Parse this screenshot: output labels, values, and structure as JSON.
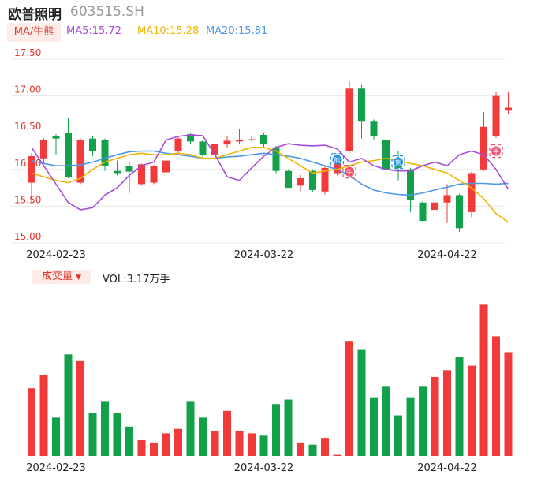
{
  "header": {
    "name": "欧普照明",
    "code": "603515.SH"
  },
  "ma_legend": {
    "tag": "MA/牛熊",
    "ma5": "MA5:15.72",
    "ma10": "MA10:15.28",
    "ma20": "MA20:15.81",
    "colors": {
      "ma5": "#a64bd8",
      "ma10": "#f2b400",
      "ma20": "#4a98e8"
    }
  },
  "volume_legend": {
    "tag": "成交量",
    "value": "VOL:3.17万手"
  },
  "colors": {
    "up": "#f23a3a",
    "down": "#12a04a"
  },
  "chart_data": {
    "type": "candlestick",
    "dates_shown": [
      "2024-02-23",
      "2024-03-22",
      "2024-04-22"
    ],
    "y_ticks": [
      "17.50",
      "17.00",
      "16.50",
      "16.00",
      "15.50",
      "15.00"
    ],
    "ylim": [
      15.0,
      17.5
    ],
    "candles": [
      {
        "o": 15.82,
        "c": 16.18,
        "h": 16.22,
        "l": 15.55,
        "up": true
      },
      {
        "o": 16.15,
        "c": 16.4,
        "h": 16.42,
        "l": 16.08,
        "up": true
      },
      {
        "o": 16.45,
        "c": 16.42,
        "h": 16.48,
        "l": 16.2,
        "up": false
      },
      {
        "o": 16.5,
        "c": 15.9,
        "h": 16.7,
        "l": 15.88,
        "up": false
      },
      {
        "o": 15.82,
        "c": 16.4,
        "h": 16.42,
        "l": 15.8,
        "up": true
      },
      {
        "o": 16.42,
        "c": 16.25,
        "h": 16.45,
        "l": 16.18,
        "up": false
      },
      {
        "o": 16.4,
        "c": 16.05,
        "h": 16.42,
        "l": 15.98,
        "up": false
      },
      {
        "o": 15.98,
        "c": 15.95,
        "h": 16.12,
        "l": 15.92,
        "up": false
      },
      {
        "o": 16.05,
        "c": 15.97,
        "h": 16.1,
        "l": 15.68,
        "up": false
      },
      {
        "o": 15.8,
        "c": 16.07,
        "h": 16.08,
        "l": 15.78,
        "up": true
      },
      {
        "o": 15.82,
        "c": 16.04,
        "h": 16.06,
        "l": 15.8,
        "up": true
      },
      {
        "o": 15.96,
        "c": 16.12,
        "h": 16.14,
        "l": 15.92,
        "up": true
      },
      {
        "o": 16.25,
        "c": 16.42,
        "h": 16.44,
        "l": 16.22,
        "up": true
      },
      {
        "o": 16.48,
        "c": 16.38,
        "h": 16.5,
        "l": 16.35,
        "up": false
      },
      {
        "o": 16.38,
        "c": 16.2,
        "h": 16.4,
        "l": 16.15,
        "up": false
      },
      {
        "o": 16.2,
        "c": 16.35,
        "h": 16.37,
        "l": 16.18,
        "up": true
      },
      {
        "o": 16.34,
        "c": 16.39,
        "h": 16.45,
        "l": 16.3,
        "up": true
      },
      {
        "o": 16.38,
        "c": 16.4,
        "h": 16.55,
        "l": 16.34,
        "up": true
      },
      {
        "o": 16.4,
        "c": 16.41,
        "h": 16.45,
        "l": 16.38,
        "up": true
      },
      {
        "o": 16.47,
        "c": 16.34,
        "h": 16.5,
        "l": 16.3,
        "up": false
      },
      {
        "o": 16.3,
        "c": 15.98,
        "h": 16.32,
        "l": 15.95,
        "up": false
      },
      {
        "o": 15.98,
        "c": 15.75,
        "h": 16.0,
        "l": 15.75,
        "up": false
      },
      {
        "o": 15.78,
        "c": 15.88,
        "h": 15.93,
        "l": 15.7,
        "up": true
      },
      {
        "o": 15.98,
        "c": 15.72,
        "h": 16.0,
        "l": 15.7,
        "up": false
      },
      {
        "o": 15.7,
        "c": 16.02,
        "h": 16.05,
        "l": 15.66,
        "up": true
      },
      {
        "o": 15.95,
        "c": 16.12,
        "h": 16.13,
        "l": 15.92,
        "up": true
      },
      {
        "o": 16.25,
        "c": 17.1,
        "h": 17.2,
        "l": 16.22,
        "up": true
      },
      {
        "o": 17.1,
        "c": 16.65,
        "h": 17.15,
        "l": 16.42,
        "up": false
      },
      {
        "o": 16.65,
        "c": 16.45,
        "h": 16.68,
        "l": 16.4,
        "up": false
      },
      {
        "o": 16.4,
        "c": 16.0,
        "h": 16.42,
        "l": 15.95,
        "up": false
      },
      {
        "o": 16.07,
        "c": 16.02,
        "h": 16.25,
        "l": 15.85,
        "up": false
      },
      {
        "o": 16.0,
        "c": 15.58,
        "h": 16.02,
        "l": 15.42,
        "up": false
      },
      {
        "o": 15.55,
        "c": 15.3,
        "h": 15.57,
        "l": 15.28,
        "up": false
      },
      {
        "o": 15.45,
        "c": 15.55,
        "h": 15.72,
        "l": 15.42,
        "up": true
      },
      {
        "o": 15.55,
        "c": 15.65,
        "h": 15.8,
        "l": 15.27,
        "up": true
      },
      {
        "o": 15.65,
        "c": 15.2,
        "h": 15.67,
        "l": 15.15,
        "up": false
      },
      {
        "o": 15.42,
        "c": 15.95,
        "h": 15.97,
        "l": 15.35,
        "up": true
      },
      {
        "o": 16.0,
        "c": 16.58,
        "h": 16.78,
        "l": 15.98,
        "up": true
      },
      {
        "o": 16.45,
        "c": 17.0,
        "h": 17.05,
        "l": 16.43,
        "up": true
      },
      {
        "o": 16.8,
        "c": 16.84,
        "h": 17.05,
        "l": 16.76,
        "up": true
      }
    ],
    "ma5": [
      16.3,
      16.05,
      15.8,
      15.55,
      15.45,
      15.48,
      15.65,
      15.75,
      15.92,
      16.05,
      16.1,
      16.4,
      16.45,
      16.47,
      16.46,
      16.2,
      15.9,
      15.85,
      16.02,
      16.18,
      16.3,
      16.35,
      16.33,
      16.32,
      16.33,
      16.28,
      16.1,
      16.15,
      16.05,
      16.0,
      15.98,
      15.98,
      16.05,
      16.1,
      16.05,
      16.2,
      16.25,
      16.2,
      16.0,
      15.73
    ],
    "ma10": [
      15.95,
      15.9,
      15.85,
      15.82,
      15.88,
      16.0,
      16.1,
      16.15,
      16.2,
      16.22,
      16.2,
      16.2,
      16.22,
      16.2,
      16.15,
      16.15,
      16.2,
      16.25,
      16.3,
      16.3,
      16.25,
      16.15,
      16.05,
      15.95,
      15.98,
      16.0,
      16.05,
      16.1,
      16.12,
      16.15,
      16.12,
      16.08,
      16.05,
      16.0,
      15.95,
      15.85,
      15.75,
      15.6,
      15.4,
      15.28
    ],
    "ma20": [
      16.12,
      16.08,
      16.05,
      16.05,
      16.06,
      16.1,
      16.15,
      16.2,
      16.24,
      16.25,
      16.25,
      16.22,
      16.2,
      16.18,
      16.15,
      16.15,
      16.17,
      16.18,
      16.2,
      16.22,
      16.2,
      16.18,
      16.15,
      16.1,
      16.05,
      16.0,
      15.92,
      15.8,
      15.72,
      15.68,
      15.66,
      15.65,
      15.68,
      15.72,
      15.76,
      15.8,
      15.81,
      15.81,
      15.8,
      15.81
    ],
    "markers": [
      {
        "index": 25,
        "label": "熊",
        "kind": "bear",
        "price": 16.13
      },
      {
        "index": 26,
        "label": "牛",
        "kind": "bull",
        "price": 15.97
      },
      {
        "index": 30,
        "label": "熊",
        "kind": "bear",
        "price": 16.1
      },
      {
        "index": 38,
        "label": "牛",
        "kind": "bull",
        "price": 16.25
      }
    ],
    "volume": [
      0.3,
      0.36,
      0.17,
      0.45,
      0.42,
      0.19,
      0.24,
      0.19,
      0.13,
      0.07,
      0.06,
      0.1,
      0.12,
      0.24,
      0.17,
      0.11,
      0.2,
      0.11,
      0.1,
      0.09,
      0.23,
      0.25,
      0.06,
      0.05,
      0.08,
      0.005,
      0.51,
      0.47,
      0.26,
      0.31,
      0.18,
      0.26,
      0.31,
      0.35,
      0.38,
      0.44,
      0.4,
      0.67,
      0.53,
      0.46
    ],
    "volume_max_label": ""
  }
}
